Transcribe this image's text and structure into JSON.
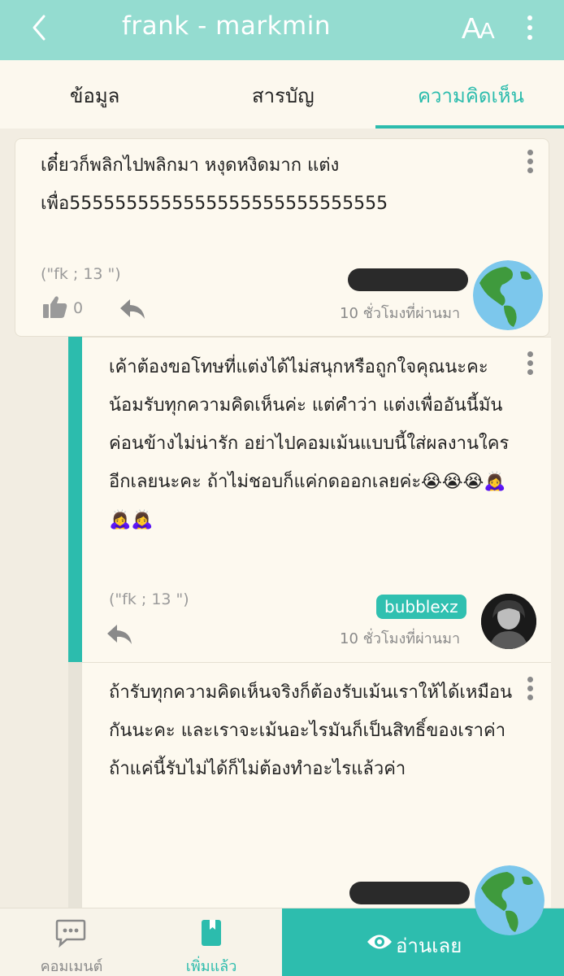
{
  "header": {
    "title": "frank - markmin",
    "font_button_big": "A",
    "font_button_small": "A",
    "back_icon": "chevron-left-icon",
    "more_icon": "vertical-dots-icon"
  },
  "tabs": {
    "info": "ข้อมูล",
    "toc": "สารบัญ",
    "comments": "ความคิดเห็น",
    "active": "comments"
  },
  "comments": [
    {
      "text": "เดี๋ยวก็พลิกไปพลิกมา หงุดหงิดมาก แต่งเพื่อ5555555555555555555555555555",
      "meta": "(\"fk ; 13 \")",
      "likes": "0",
      "time": "10 ชั่วโมงที่ผ่านมา",
      "username_redacted": true,
      "avatar": "globe-avatar"
    },
    {
      "text": "เค้าต้องขอโทษที่แต่งได้ไม่สนุกหรือถูกใจคุณนะคะ น้อมรับทุกความคิดเห็นค่ะ แต่คำว่า แต่งเพื่ออันนี้มันค่อนข้างไม่น่ารัก อย่าไปคอมเม้นแบบนี้ใส่ผลงานใครอีกเลยนะคะ ถ้าไม่ชอบก็แค่กดออกเลยค่ะ😭😭😭🙇‍♀️🙇‍♀️🙇‍♀️",
      "meta": "(\"fk ; 13 \")",
      "username": "bubblexz",
      "time": "10 ชั่วโมงที่ผ่านมา",
      "avatar": "photo-avatar"
    },
    {
      "text": "ถ้ารับทุกความคิดเห็นจริงก็ต้องรับเม้นเราให้ได้เหมือนกันนะคะ และเราจะเม้นอะไรมันก็เป็นสิทธิ์ของเราค่า ถ้าแค่นี้รับไม่ได้ก็ไม่ต้องทำอะไรแล้วค่า",
      "username_redacted": true,
      "avatar": "globe-avatar"
    }
  ],
  "bottom_bar": {
    "comment_label": "คอมเมนต์",
    "saved_label": "เพิ่มแล้ว",
    "read_label": "อ่านเลย"
  },
  "colors": {
    "header_bg": "#94dcd0",
    "accent": "#2cbcad",
    "card_bg": "#fdf9ef",
    "page_bg": "#f2ede2"
  }
}
